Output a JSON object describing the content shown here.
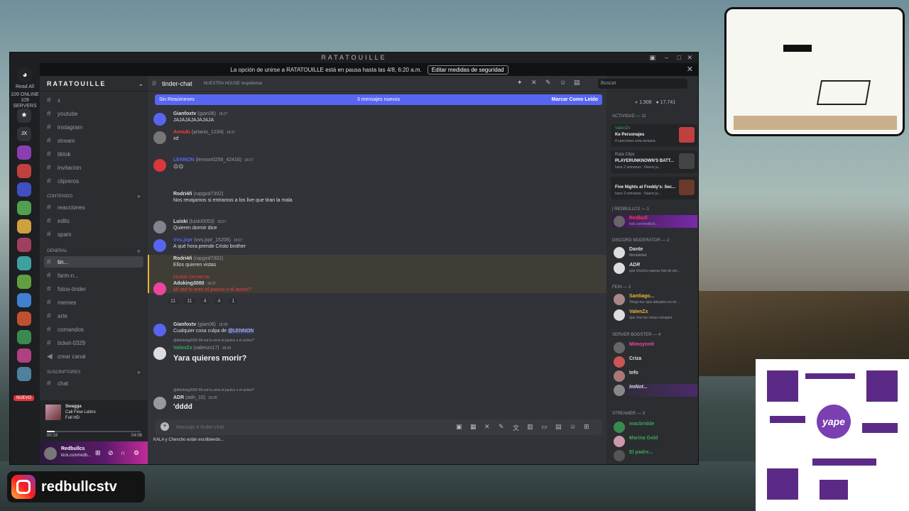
{
  "window": {
    "title": "RATATOUILLE"
  },
  "banner": {
    "text": "La opción de unirse a RATATOUILLE está en pausa hasta las 4/8, 6:20 a.m.",
    "button": "Editar medidas de seguridad"
  },
  "rail": {
    "read_all": "Read All",
    "online": "109 ONLINE",
    "servers": "109 SERVERS",
    "badge_new": "NUEVO"
  },
  "sidebar": {
    "server_name": "RATATOUILLE",
    "channels": [
      {
        "label": "x"
      },
      {
        "label": "youtube"
      },
      {
        "label": "instagram"
      },
      {
        "label": "stream"
      },
      {
        "label": "tiktok"
      },
      {
        "label": "invitacion"
      },
      {
        "label": "clipreros"
      }
    ],
    "category_contenido": "CONTENIDO",
    "contenido_channels": [
      {
        "label": "reacciones"
      },
      {
        "label": "edits"
      },
      {
        "label": "spam"
      }
    ],
    "category_general": "GENERAL",
    "general_channels": [
      {
        "label": "tin..."
      },
      {
        "label": "farm-n..."
      },
      {
        "label": "fotos-tinder"
      },
      {
        "label": "memes"
      },
      {
        "label": "arte"
      },
      {
        "label": "comandos"
      },
      {
        "label": "ticket-0329"
      },
      {
        "label": "crear canal"
      }
    ],
    "category_suscriptores": "SUSCRIPTORES",
    "sub_channels": [
      {
        "label": "chat"
      }
    ],
    "player": {
      "title": "Swagga",
      "artist": "Cali Flow Latino",
      "quality": "Full HD",
      "elapsed": "00:19",
      "total": "04:06",
      "progress": 0.08
    },
    "user": {
      "name": "Redbullcs",
      "status": "kick.com/redb..."
    }
  },
  "chat": {
    "channel": "tinder-chat",
    "topic": "NUESTRA HOUSE respétense",
    "new_bar": {
      "left": "Sin Reaúmenes",
      "center": "3 mensajes nuevos",
      "right": "Marcar Como Leído"
    },
    "messages": [
      {
        "name": "Gianfoxtv",
        "extra": "(gian08)",
        "time": "18:27",
        "text": "JAJAJAJAJAJAJA",
        "color": "#dbdee1"
      },
      {
        "name": "Annuki",
        "extra": "(artanis_1234)",
        "time": "18:27",
        "text": "xd",
        "color": "#f23f43"
      },
      {
        "name": "LENNON",
        "extra": "(lennon0256_42416)",
        "time": "18:27",
        "text": "😐😐",
        "color": "#dbdee1"
      },
      {
        "name": "Rodri4ñ",
        "extra": "(rapgod7302)",
        "time": "",
        "text": "Nos revajamos si entramos a los live que tiran la mala",
        "color": "#dbdee1"
      },
      {
        "name": "Luiski",
        "extra": "(luiski0053)",
        "time": "18:27",
        "text": "Quieren dormir dice",
        "color": "#dbdee1"
      },
      {
        "name": "Vvs.jxpr",
        "extra": "(vvs.jxpr_15206)",
        "time": "18:27",
        "text": "A qué hora prende Cristo brother",
        "color": "#dbdee1"
      },
      {
        "name": "Rodri4ñ",
        "extra": "(rapgod7302)",
        "time": "",
        "text": "Ellos quieren vistas",
        "color": "#dbdee1"
      },
      {
        "name": "Adoking3000",
        "extra": "",
        "time": "18:27",
        "text": "Mi red tu eres el pasivo o el activo?",
        "reply": "DEJAME CACHAR OE",
        "color": "#dbdee1"
      },
      {
        "name": "Gianfoxtv",
        "extra": "(gian08)",
        "time": "18:28",
        "text": "Cualquier cosa culpa de",
        "mention": "@LENNON",
        "color": "#dbdee1"
      },
      {
        "name": "ValenZx",
        "extra": "(valenzx17)",
        "time": "18:28",
        "text": "Yara quieres morir?",
        "reply": "@Adoking3000 Mi red tu eres el pasivo o el activo?",
        "color": "#3ba55d"
      },
      {
        "name": "ADR",
        "extra": "(adri_10)",
        "time": "18:28",
        "text": "'dddd",
        "reply": "@Adoking3000 Mi red tu eres el pasivo o el activo?",
        "color": "#dbdee1"
      }
    ],
    "reactions": [
      "11",
      "11",
      "4",
      "4",
      "1"
    ],
    "input_placeholder": "Mensaje # tinder-chat",
    "typing": "KALA y Chencho están escribiendo..."
  },
  "members": {
    "search_placeholder": "Buscar",
    "stat_online": "1,908",
    "stat_total": "17,741",
    "activity_header": "Actividad — 11",
    "activities": [
      {
        "user": "ValenZx",
        "title": "Ke Personajes",
        "sub": "4 canciones esta semana"
      },
      {
        "user": "Rata Clips",
        "title": "PLAYERUNKNOWN'S BATT...",
        "sub": "hace 2 semanas · Nuevo ju..."
      },
      {
        "user": "",
        "title": "Five Nights at Freddy's: Sec...",
        "sub": "hace 2 semanas · Nuevo ju..."
      }
    ],
    "groups": [
      {
        "header": "| REDBULLCS — 1",
        "members": [
          {
            "name": "Redbull",
            "sub": "kick.com/redbull...",
            "color": "#f23f43"
          }
        ]
      },
      {
        "header": "DISCORD MODERATOR — 2",
        "members": [
          {
            "name": "Dante",
            "sub": "Mentalidad",
            "color": "#f2f3f5"
          },
          {
            "name": "ADR",
            "sub": "que chucha sapeas hijo de per...",
            "color": "#f2f3f5"
          }
        ]
      },
      {
        "header": "FEIN — 2",
        "members": [
          {
            "name": "Santiago...",
            "sub": "Tengo tus ojos tatuados en mi ...",
            "color": "#f0b232"
          },
          {
            "name": "ValenZx",
            "sub": "que cha me miras compare",
            "color": "#f0b232"
          }
        ]
      },
      {
        "header": "SERVER BOOSTER — 4",
        "members": [
          {
            "name": "Mimoyonit",
            "sub": "",
            "color": "#eb459e"
          },
          {
            "name": "Criza",
            "sub": "",
            "color": "#f2f3f5"
          },
          {
            "name": "tefo",
            "sub": "",
            "color": "#f2f3f5"
          },
          {
            "name": "ImNot...",
            "sub": "",
            "color": "#f2f3f5"
          }
        ]
      },
      {
        "header": "STREAMER — 3",
        "members": [
          {
            "name": "macbridde",
            "sub": "",
            "color": "#3ba55d"
          },
          {
            "name": "Marina Gold",
            "sub": "",
            "color": "#3ba55d"
          },
          {
            "name": "El padre...",
            "sub": "",
            "color": "#3ba55d"
          }
        ]
      }
    ]
  },
  "overlays": {
    "instagram_handle": "redbullcstv",
    "qr_logo": "yape"
  }
}
